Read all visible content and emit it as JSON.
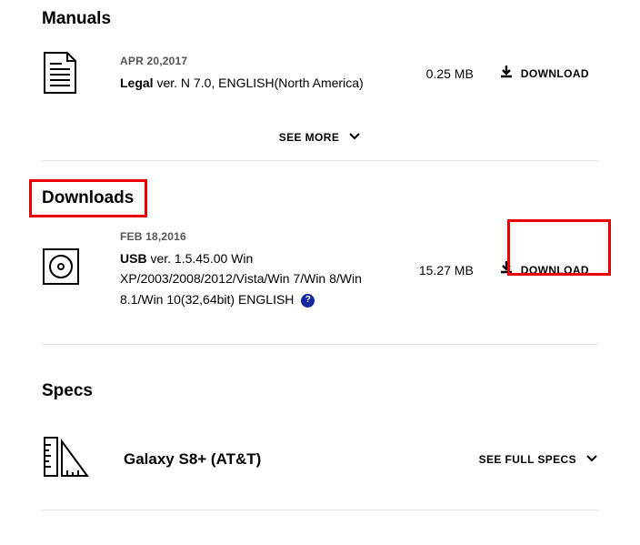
{
  "manuals": {
    "heading": "Manuals",
    "item": {
      "date": "APR 20,2017",
      "name": "Legal",
      "detail": " ver. N 7.0, ENGLISH(North America)",
      "size": "0.25 MB",
      "download": "DOWNLOAD"
    },
    "see_more": "SEE MORE"
  },
  "downloads": {
    "heading": "Downloads",
    "item": {
      "date": "FEB 18,2016",
      "name": "USB",
      "detail": " ver. 1.5.45.00 Win XP/2003/2008/2012/Vista/Win 7/Win 8/Win 8.1/Win 10(32,64bit) ENGLISH",
      "size": "15.27 MB",
      "download": "DOWNLOAD"
    }
  },
  "specs": {
    "heading": "Specs",
    "title": "Galaxy S8+ (AT&T)",
    "see_full": "SEE FULL SPECS"
  }
}
